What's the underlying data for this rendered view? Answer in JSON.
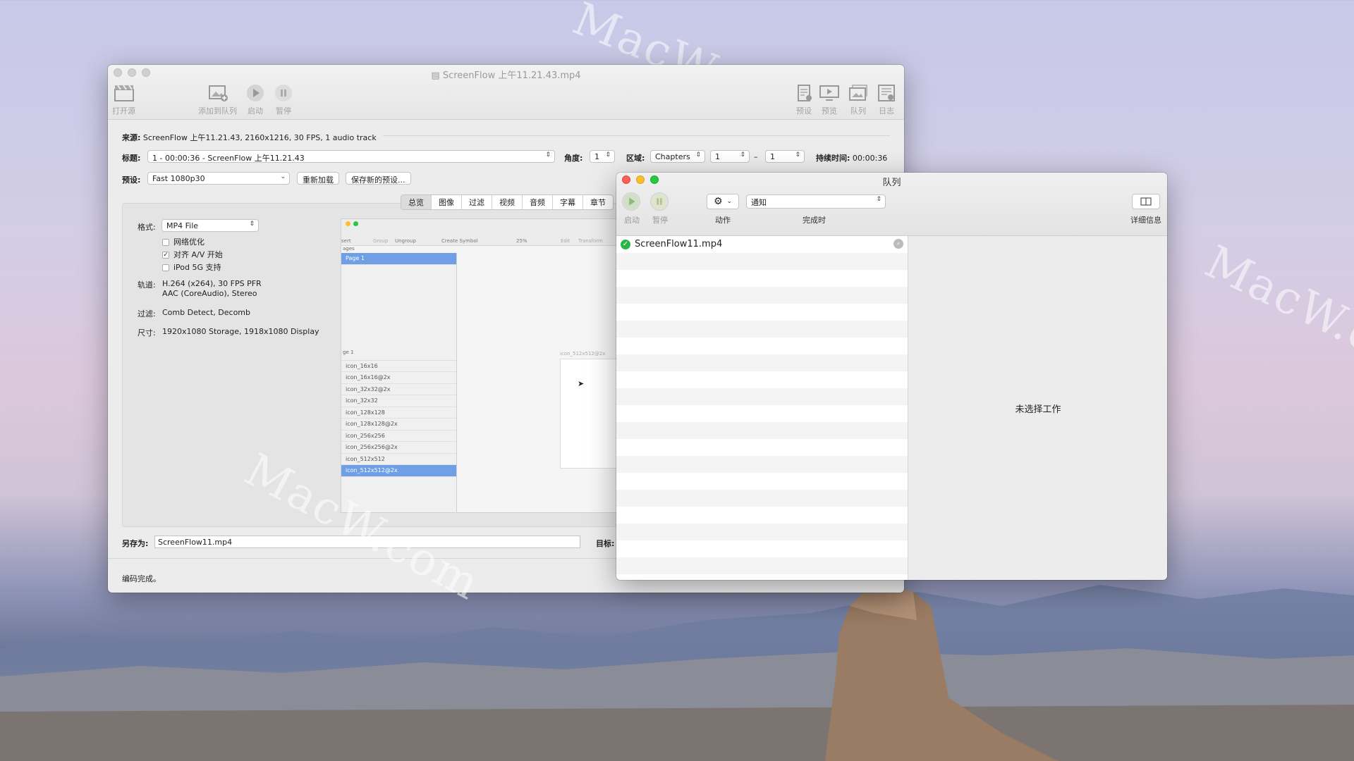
{
  "watermarks": [
    "MacW.com",
    "MacW.com",
    "MacW.com"
  ],
  "main_window": {
    "title": "ScreenFlow 上午11.21.43.mp4",
    "toolbar": {
      "open_source": "打开源",
      "add_to_queue": "添加到队列",
      "start": "启动",
      "pause": "暂停",
      "presets": "预设",
      "preview": "预览",
      "queue": "队列",
      "log": "日志"
    },
    "source_label": "来源:",
    "source_value": "ScreenFlow 上午11.21.43, 2160x1216, 30 FPS, 1 audio track",
    "title_label": "标题:",
    "title_value": "1 - 00:00:36 - ScreenFlow 上午11.21.43",
    "angle_label": "角度:",
    "angle_value": "1",
    "range_label": "区域:",
    "range_type": "Chapters",
    "range_start": "1",
    "range_dash": "–",
    "range_end": "1",
    "duration_label": "持续时间:",
    "duration_value": "00:00:36",
    "preset_label": "预设:",
    "preset_value": "Fast 1080p30",
    "reload_button": "重新加载",
    "save_preset_button": "保存新的预设...",
    "tabs": [
      "总览",
      "图像",
      "过滤",
      "视频",
      "音频",
      "字幕",
      "章节"
    ],
    "format_label": "格式:",
    "format_value": "MP4 File",
    "web_optimized": "网络优化",
    "align_av": "对齐 A/V 开始",
    "ipod_support": "iPod 5G 支持",
    "tracks_label": "轨道:",
    "tracks_line1": "H.264 (x264), 30 FPS PFR",
    "tracks_line2": "AAC (CoreAudio), Stereo",
    "filters_label": "过滤:",
    "filters_value": "Comb Detect, Decomb",
    "size_label": "尺寸:",
    "size_value": "1920x1080 Storage, 1918x1080 Display",
    "save_as_label": "另存为:",
    "save_as_value": "ScreenFlow11.mp4",
    "dest_label": "目标:",
    "status": "编码完成。"
  },
  "preview": {
    "toolbar": [
      "sert",
      "Group",
      "Ungroup",
      "Create Symbol",
      "25%",
      "Edit",
      "Transform"
    ],
    "pages_header": "ages",
    "page_item": "Page 1",
    "layers_header": "ge 1",
    "layers": [
      "icon_16x16",
      "icon_16x16@2x",
      "icon_32x32@2x",
      "icon_32x32",
      "icon_128x128",
      "icon_128x128@2x",
      "icon_256x256",
      "icon_256x256@2x",
      "icon_512x512",
      "icon_512x512@2x"
    ],
    "artboard_label": "icon_512x512@2x"
  },
  "queue_window": {
    "title": "队列",
    "start": "启动",
    "pause": "暂停",
    "action_label": "动作",
    "when_done_label": "完成时",
    "when_done_value": "通知",
    "details_label": "详细信息",
    "items": [
      {
        "name": "ScreenFlow11.mp4",
        "status": "done"
      }
    ],
    "no_selection": "未选择工作"
  },
  "colors": {
    "accent_blue": "#6f9fe4",
    "success_green": "#2bb44a"
  }
}
